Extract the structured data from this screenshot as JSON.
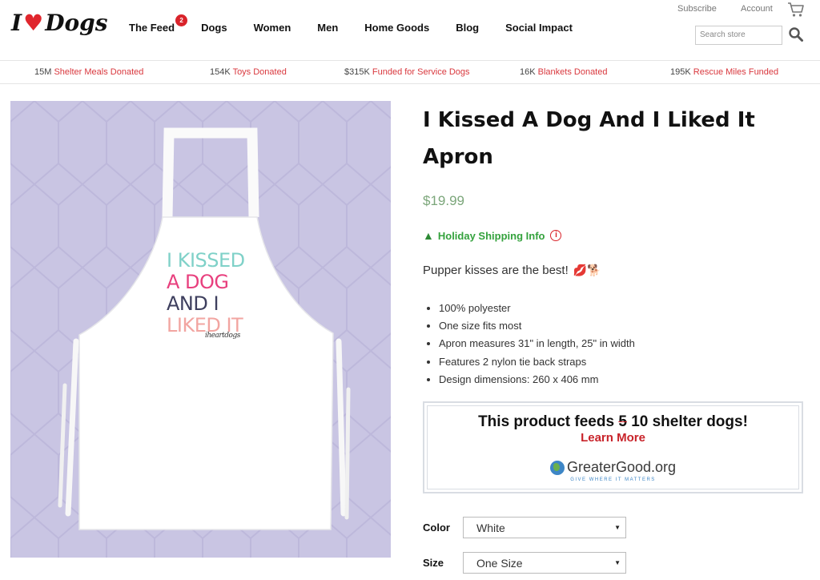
{
  "header": {
    "logo": {
      "left": "I",
      "right": "Dogs"
    },
    "nav": [
      {
        "label": "The Feed",
        "badge": "2"
      },
      {
        "label": "Dogs"
      },
      {
        "label": "Women"
      },
      {
        "label": "Men"
      },
      {
        "label": "Home Goods"
      },
      {
        "label": "Blog"
      },
      {
        "label": "Social Impact"
      }
    ],
    "subscribe": "Subscribe",
    "account": "Account",
    "search_placeholder": "Search store"
  },
  "stats": [
    {
      "value": "15M",
      "label": "Shelter Meals Donated"
    },
    {
      "value": "154K",
      "label": "Toys Donated"
    },
    {
      "value": "$315K",
      "label": "Funded for Service Dogs"
    },
    {
      "value": "16K",
      "label": "Blankets Donated"
    },
    {
      "value": "195K",
      "label": "Rescue Miles Funded"
    }
  ],
  "product": {
    "image_text": [
      "I KISSED",
      "A DOG",
      "AND I",
      "LIKED IT"
    ],
    "image_signature": "iheartdogs",
    "title": "I Kissed A Dog And I Liked It Apron",
    "price": "$19.99",
    "shipping": "Holiday Shipping Info",
    "description": "Pupper kisses are the best!",
    "description_emoji": "💋🐕",
    "bullets": [
      "100% polyester",
      "One size fits most",
      "Apron measures 31\" in length, 25\" in width",
      "Features 2 nylon tie back straps",
      "Design dimensions: 260 x 406 mm"
    ],
    "feeds": {
      "prefix": "This product feeds",
      "old_count": "5",
      "new_count": "10",
      "suffix": "shelter dogs!",
      "learn_more": "Learn More",
      "partner": "GreaterGood.org",
      "partner_tagline": "GIVE WHERE IT MATTERS"
    },
    "options": {
      "color_label": "Color",
      "color_value": "White",
      "size_label": "Size",
      "size_value": "One Size"
    }
  },
  "colors": {
    "accent_red": "#d9232a",
    "price_green": "#7ba67a",
    "shipping_green": "#34a23d",
    "image_bg": "#c9c5e3"
  }
}
